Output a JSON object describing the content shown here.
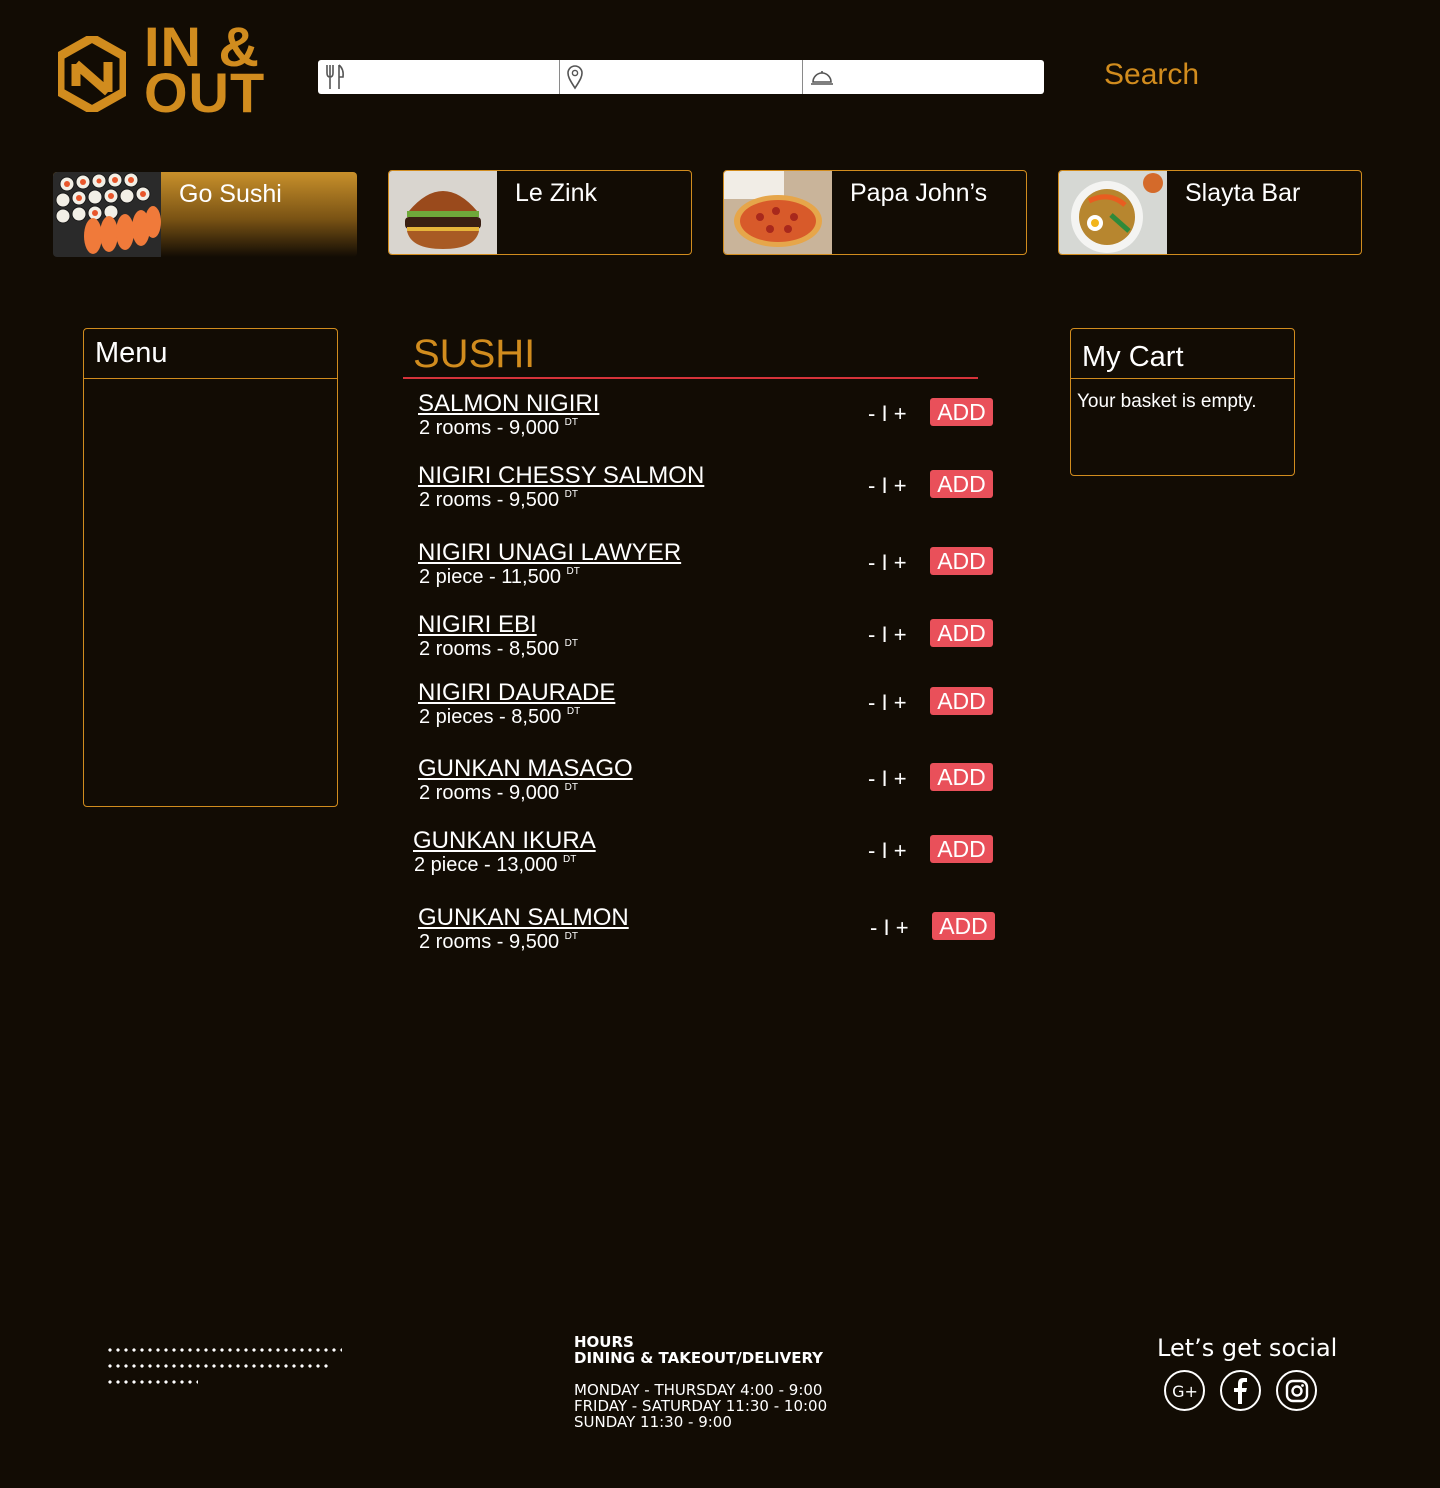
{
  "brand": {
    "line1": "IN &",
    "line2": "OUT",
    "color": "#d18c1e"
  },
  "search": {
    "food_placeholder": "",
    "location_placeholder": "",
    "service_placeholder": "",
    "button_label": "Search"
  },
  "restaurants": [
    {
      "name": "Go Sushi",
      "active": true
    },
    {
      "name": "Le Zink",
      "active": false
    },
    {
      "name": "Papa John’s",
      "active": false
    },
    {
      "name": "Slayta Bar",
      "active": false
    }
  ],
  "menu_panel": {
    "title": "Menu"
  },
  "section": {
    "title": "SUSHI"
  },
  "items": [
    {
      "name": "SALMON NIGIRI",
      "qty": "2 rooms",
      "price": "9,000",
      "currency": "DT"
    },
    {
      "name": "NIGIRI CHESSY SALMON",
      "qty": "2 rooms",
      "price": "9,500",
      "currency": "DT"
    },
    {
      "name": "NIGIRI UNAGI LAWYER",
      "qty": "2 piece",
      "price": "11,500",
      "currency": "DT"
    },
    {
      "name": "NIGIRI EBI",
      "qty": "2 rooms",
      "price": "8,500",
      "currency": "DT"
    },
    {
      "name": "NIGIRI DAURADE",
      "qty": "2 pieces",
      "price": "8,500",
      "currency": "DT"
    },
    {
      "name": "GUNKAN MASAGO",
      "qty": "2 rooms",
      "price": "9,000",
      "currency": "DT"
    },
    {
      "name": "GUNKAN IKURA",
      "qty": "2 piece",
      "price": "13,000",
      "currency": "DT"
    },
    {
      "name": "GUNKAN SALMON",
      "qty": "2 rooms",
      "price": "9,500",
      "currency": "DT"
    }
  ],
  "controls": {
    "minus": "-",
    "separator": "I",
    "plus": "+",
    "add": "ADD"
  },
  "cart": {
    "title": "My Cart",
    "empty_text": "Your basket is empty."
  },
  "footer": {
    "hours_title": "HOURS",
    "hours_subtitle": "DINING & TAKEOUT/DELIVERY",
    "hours": [
      "MONDAY - THURSDAY 4:00 - 9:00",
      "FRIDAY - SATURDAY 11:30 - 10:00",
      "SUNDAY 11:30 - 9:00"
    ],
    "social_title": "Let’s get social",
    "social_icons": [
      "google-plus-icon",
      "facebook-icon",
      "instagram-icon"
    ]
  },
  "colors": {
    "background": "#120c04",
    "accent": "#d18c1e",
    "add_button": "#e9505a",
    "section_rule": "#d6333a"
  }
}
